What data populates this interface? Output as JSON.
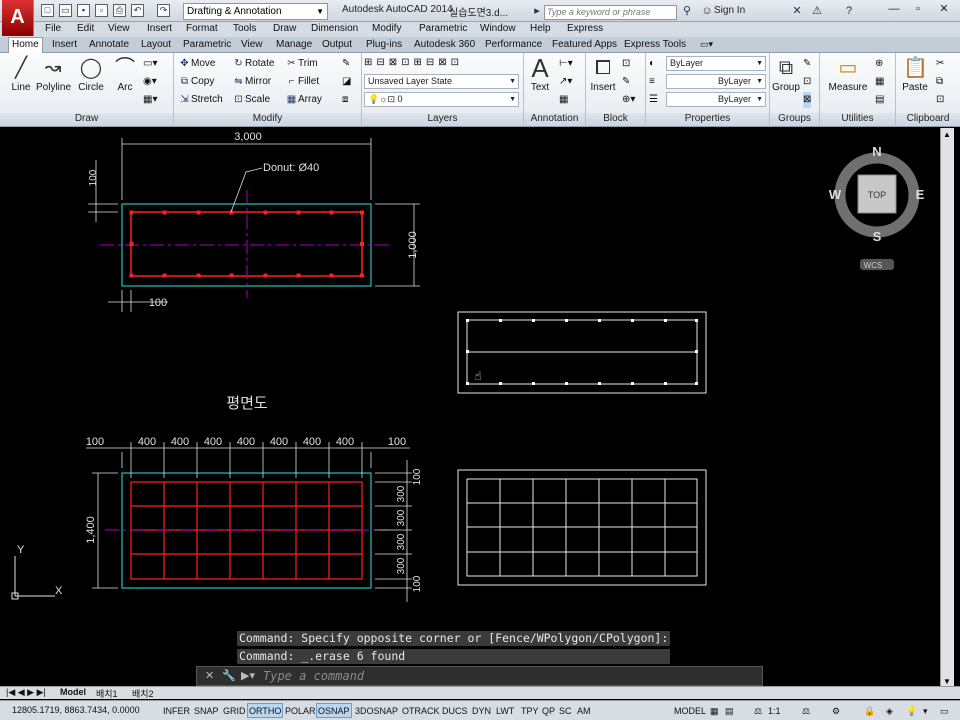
{
  "app": {
    "logo": "A",
    "title": "Autodesk AutoCAD 2014",
    "file": "실습도면3.d...",
    "workspace": "Drafting & Annotation",
    "search_placeholder": "Type a keyword or phrase",
    "sign_in": "Sign In"
  },
  "menu": [
    "File",
    "Edit",
    "View",
    "Insert",
    "Format",
    "Tools",
    "Draw",
    "Dimension",
    "Modify",
    "Parametric",
    "Window",
    "Help",
    "Express"
  ],
  "ribbon_tabs": [
    "Home",
    "Insert",
    "Annotate",
    "Layout",
    "Parametric",
    "View",
    "Manage",
    "Output",
    "Plug-ins",
    "Autodesk 360",
    "Performance",
    "Featured Apps",
    "Express Tools"
  ],
  "ribbon": {
    "draw": {
      "title": "Draw",
      "line": "Line",
      "polyline": "Polyline",
      "circle": "Circle",
      "arc": "Arc"
    },
    "modify": {
      "title": "Modify",
      "move": "Move",
      "rotate": "Rotate",
      "trim": "Trim",
      "copy": "Copy",
      "mirror": "Mirror",
      "fillet": "Fillet",
      "stretch": "Stretch",
      "scale": "Scale",
      "array": "Array"
    },
    "layers": {
      "title": "Layers",
      "state": "Unsaved Layer State",
      "current": "0"
    },
    "annotation": {
      "title": "Annotation",
      "text": "Text"
    },
    "block": {
      "title": "Block",
      "insert": "Insert"
    },
    "properties": {
      "title": "Properties",
      "color": "ByLayer",
      "linetype": "ByLayer",
      "lineweight": "ByLayer"
    },
    "groups": {
      "title": "Groups",
      "group": "Group"
    },
    "utilities": {
      "title": "Utilities",
      "measure": "Measure"
    },
    "clipboard": {
      "title": "Clipboard",
      "paste": "Paste"
    }
  },
  "drawing": {
    "dim_top": "3,000",
    "donut_label": "Donut: Ø40",
    "dim_left_top": "100",
    "dim_right": "1,000",
    "dim_bottom_small": "100",
    "plan_label": "평면도",
    "grid_dims_top": [
      "100",
      "400",
      "400",
      "400",
      "400",
      "400",
      "400",
      "400",
      "100"
    ],
    "dim_left_grid": "1,400",
    "grid_dims_right": [
      "100",
      "300",
      "300",
      "300",
      "300",
      "100"
    ],
    "ucs_y": "Y",
    "ucs_x": "X"
  },
  "viewcube": {
    "n": "N",
    "s": "S",
    "e": "E",
    "w": "W",
    "face": "TOP",
    "wcs": "WCS"
  },
  "command": {
    "history": [
      "Command: Specify opposite corner or [Fence/WPolygon/CPolygon]:",
      "Command: _.erase 6 found"
    ],
    "placeholder": "Type a command"
  },
  "layout_tabs": [
    "Model",
    "배치1",
    "배치2"
  ],
  "status": {
    "coords": "12805.1719, 8863.7434, 0.0000",
    "toggles": [
      "INFER",
      "SNAP",
      "GRID",
      "ORTHO",
      "POLAR",
      "OSNAP",
      "3DOSNAP",
      "OTRACK",
      "DUCS",
      "DYN",
      "LWT",
      "TPY",
      "QP",
      "SC",
      "AM"
    ],
    "active": [
      "ORTHO",
      "OSNAP"
    ],
    "model": "MODEL",
    "scale": "1:1"
  },
  "colors": {
    "canvas": "#000000",
    "dim": "#e0e0e0",
    "rebar": "#ff2020",
    "center": "#b000c0",
    "outline": "#20c0c0",
    "accent": "#b9d6f2"
  }
}
